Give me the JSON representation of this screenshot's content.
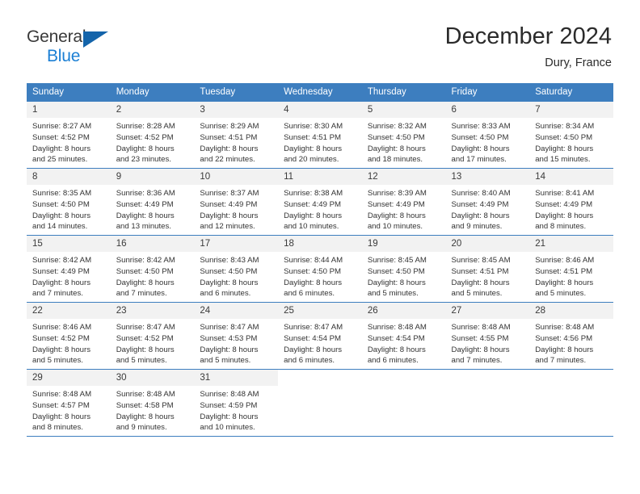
{
  "brand": {
    "name_primary": "General",
    "name_secondary": "Blue",
    "primary_color": "#3a3a3a",
    "secondary_color": "#1b7fd4",
    "triangle_color": "#1464aa"
  },
  "header": {
    "month_title": "December 2024",
    "location": "Dury, France",
    "header_bg_color": "#3d7ebf",
    "header_text_color": "#ffffff"
  },
  "weekdays": [
    "Sunday",
    "Monday",
    "Tuesday",
    "Wednesday",
    "Thursday",
    "Friday",
    "Saturday"
  ],
  "weeks": [
    [
      {
        "day": "1",
        "sunrise": "Sunrise: 8:27 AM",
        "sunset": "Sunset: 4:52 PM",
        "daylight_line1": "Daylight: 8 hours",
        "daylight_line2": "and 25 minutes."
      },
      {
        "day": "2",
        "sunrise": "Sunrise: 8:28 AM",
        "sunset": "Sunset: 4:52 PM",
        "daylight_line1": "Daylight: 8 hours",
        "daylight_line2": "and 23 minutes."
      },
      {
        "day": "3",
        "sunrise": "Sunrise: 8:29 AM",
        "sunset": "Sunset: 4:51 PM",
        "daylight_line1": "Daylight: 8 hours",
        "daylight_line2": "and 22 minutes."
      },
      {
        "day": "4",
        "sunrise": "Sunrise: 8:30 AM",
        "sunset": "Sunset: 4:51 PM",
        "daylight_line1": "Daylight: 8 hours",
        "daylight_line2": "and 20 minutes."
      },
      {
        "day": "5",
        "sunrise": "Sunrise: 8:32 AM",
        "sunset": "Sunset: 4:50 PM",
        "daylight_line1": "Daylight: 8 hours",
        "daylight_line2": "and 18 minutes."
      },
      {
        "day": "6",
        "sunrise": "Sunrise: 8:33 AM",
        "sunset": "Sunset: 4:50 PM",
        "daylight_line1": "Daylight: 8 hours",
        "daylight_line2": "and 17 minutes."
      },
      {
        "day": "7",
        "sunrise": "Sunrise: 8:34 AM",
        "sunset": "Sunset: 4:50 PM",
        "daylight_line1": "Daylight: 8 hours",
        "daylight_line2": "and 15 minutes."
      }
    ],
    [
      {
        "day": "8",
        "sunrise": "Sunrise: 8:35 AM",
        "sunset": "Sunset: 4:50 PM",
        "daylight_line1": "Daylight: 8 hours",
        "daylight_line2": "and 14 minutes."
      },
      {
        "day": "9",
        "sunrise": "Sunrise: 8:36 AM",
        "sunset": "Sunset: 4:49 PM",
        "daylight_line1": "Daylight: 8 hours",
        "daylight_line2": "and 13 minutes."
      },
      {
        "day": "10",
        "sunrise": "Sunrise: 8:37 AM",
        "sunset": "Sunset: 4:49 PM",
        "daylight_line1": "Daylight: 8 hours",
        "daylight_line2": "and 12 minutes."
      },
      {
        "day": "11",
        "sunrise": "Sunrise: 8:38 AM",
        "sunset": "Sunset: 4:49 PM",
        "daylight_line1": "Daylight: 8 hours",
        "daylight_line2": "and 10 minutes."
      },
      {
        "day": "12",
        "sunrise": "Sunrise: 8:39 AM",
        "sunset": "Sunset: 4:49 PM",
        "daylight_line1": "Daylight: 8 hours",
        "daylight_line2": "and 10 minutes."
      },
      {
        "day": "13",
        "sunrise": "Sunrise: 8:40 AM",
        "sunset": "Sunset: 4:49 PM",
        "daylight_line1": "Daylight: 8 hours",
        "daylight_line2": "and 9 minutes."
      },
      {
        "day": "14",
        "sunrise": "Sunrise: 8:41 AM",
        "sunset": "Sunset: 4:49 PM",
        "daylight_line1": "Daylight: 8 hours",
        "daylight_line2": "and 8 minutes."
      }
    ],
    [
      {
        "day": "15",
        "sunrise": "Sunrise: 8:42 AM",
        "sunset": "Sunset: 4:49 PM",
        "daylight_line1": "Daylight: 8 hours",
        "daylight_line2": "and 7 minutes."
      },
      {
        "day": "16",
        "sunrise": "Sunrise: 8:42 AM",
        "sunset": "Sunset: 4:50 PM",
        "daylight_line1": "Daylight: 8 hours",
        "daylight_line2": "and 7 minutes."
      },
      {
        "day": "17",
        "sunrise": "Sunrise: 8:43 AM",
        "sunset": "Sunset: 4:50 PM",
        "daylight_line1": "Daylight: 8 hours",
        "daylight_line2": "and 6 minutes."
      },
      {
        "day": "18",
        "sunrise": "Sunrise: 8:44 AM",
        "sunset": "Sunset: 4:50 PM",
        "daylight_line1": "Daylight: 8 hours",
        "daylight_line2": "and 6 minutes."
      },
      {
        "day": "19",
        "sunrise": "Sunrise: 8:45 AM",
        "sunset": "Sunset: 4:50 PM",
        "daylight_line1": "Daylight: 8 hours",
        "daylight_line2": "and 5 minutes."
      },
      {
        "day": "20",
        "sunrise": "Sunrise: 8:45 AM",
        "sunset": "Sunset: 4:51 PM",
        "daylight_line1": "Daylight: 8 hours",
        "daylight_line2": "and 5 minutes."
      },
      {
        "day": "21",
        "sunrise": "Sunrise: 8:46 AM",
        "sunset": "Sunset: 4:51 PM",
        "daylight_line1": "Daylight: 8 hours",
        "daylight_line2": "and 5 minutes."
      }
    ],
    [
      {
        "day": "22",
        "sunrise": "Sunrise: 8:46 AM",
        "sunset": "Sunset: 4:52 PM",
        "daylight_line1": "Daylight: 8 hours",
        "daylight_line2": "and 5 minutes."
      },
      {
        "day": "23",
        "sunrise": "Sunrise: 8:47 AM",
        "sunset": "Sunset: 4:52 PM",
        "daylight_line1": "Daylight: 8 hours",
        "daylight_line2": "and 5 minutes."
      },
      {
        "day": "24",
        "sunrise": "Sunrise: 8:47 AM",
        "sunset": "Sunset: 4:53 PM",
        "daylight_line1": "Daylight: 8 hours",
        "daylight_line2": "and 5 minutes."
      },
      {
        "day": "25",
        "sunrise": "Sunrise: 8:47 AM",
        "sunset": "Sunset: 4:54 PM",
        "daylight_line1": "Daylight: 8 hours",
        "daylight_line2": "and 6 minutes."
      },
      {
        "day": "26",
        "sunrise": "Sunrise: 8:48 AM",
        "sunset": "Sunset: 4:54 PM",
        "daylight_line1": "Daylight: 8 hours",
        "daylight_line2": "and 6 minutes."
      },
      {
        "day": "27",
        "sunrise": "Sunrise: 8:48 AM",
        "sunset": "Sunset: 4:55 PM",
        "daylight_line1": "Daylight: 8 hours",
        "daylight_line2": "and 7 minutes."
      },
      {
        "day": "28",
        "sunrise": "Sunrise: 8:48 AM",
        "sunset": "Sunset: 4:56 PM",
        "daylight_line1": "Daylight: 8 hours",
        "daylight_line2": "and 7 minutes."
      }
    ],
    [
      {
        "day": "29",
        "sunrise": "Sunrise: 8:48 AM",
        "sunset": "Sunset: 4:57 PM",
        "daylight_line1": "Daylight: 8 hours",
        "daylight_line2": "and 8 minutes."
      },
      {
        "day": "30",
        "sunrise": "Sunrise: 8:48 AM",
        "sunset": "Sunset: 4:58 PM",
        "daylight_line1": "Daylight: 8 hours",
        "daylight_line2": "and 9 minutes."
      },
      {
        "day": "31",
        "sunrise": "Sunrise: 8:48 AM",
        "sunset": "Sunset: 4:59 PM",
        "daylight_line1": "Daylight: 8 hours",
        "daylight_line2": "and 10 minutes."
      },
      {
        "day": "",
        "sunrise": "",
        "sunset": "",
        "daylight_line1": "",
        "daylight_line2": ""
      },
      {
        "day": "",
        "sunrise": "",
        "sunset": "",
        "daylight_line1": "",
        "daylight_line2": ""
      },
      {
        "day": "",
        "sunrise": "",
        "sunset": "",
        "daylight_line1": "",
        "daylight_line2": ""
      },
      {
        "day": "",
        "sunrise": "",
        "sunset": "",
        "daylight_line1": "",
        "daylight_line2": ""
      }
    ]
  ]
}
